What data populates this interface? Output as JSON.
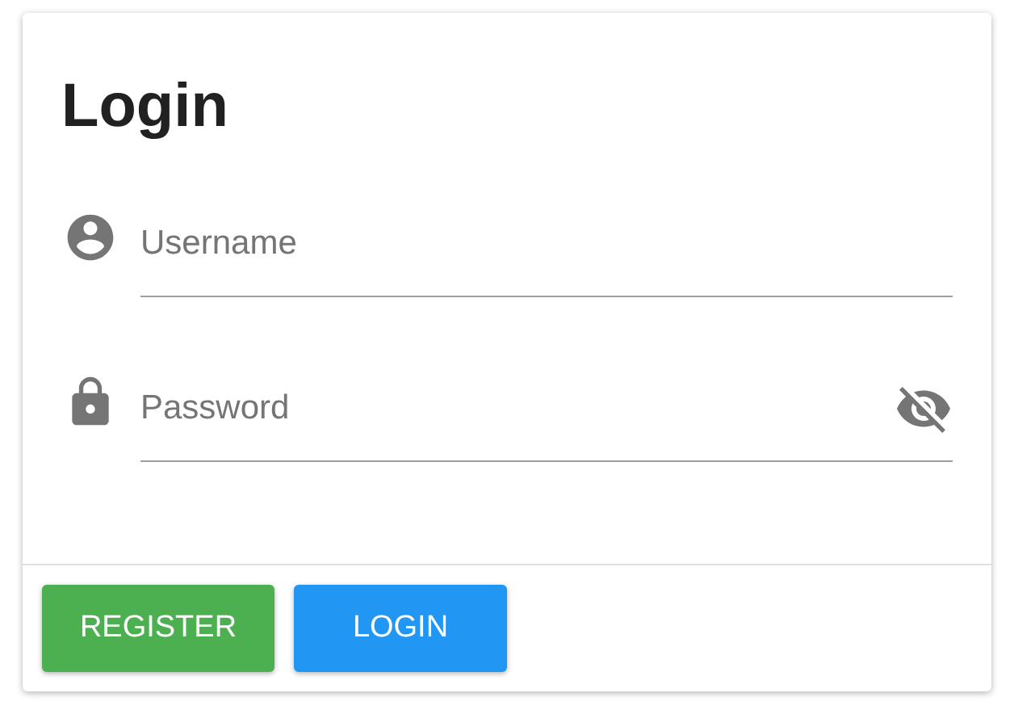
{
  "card": {
    "title": "Login"
  },
  "fields": [
    {
      "kind": "username",
      "placeholder": "Username"
    },
    {
      "kind": "password",
      "placeholder": "Password"
    }
  ],
  "buttons": [
    {
      "label": "REGISTER",
      "color": "#4caf50"
    },
    {
      "label": "LOGIN",
      "color": "#2196f3"
    }
  ]
}
